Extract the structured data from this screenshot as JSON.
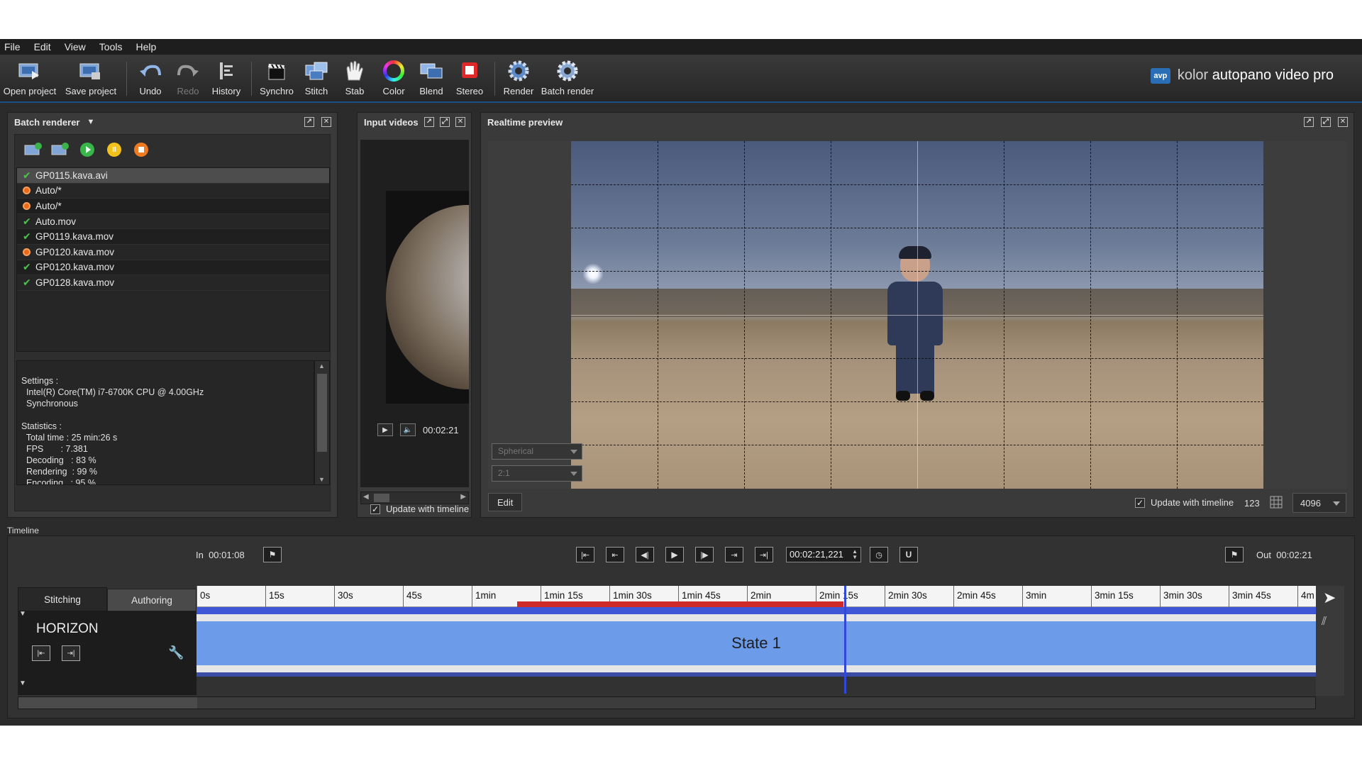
{
  "menu": [
    "File",
    "Edit",
    "View",
    "Tools",
    "Help"
  ],
  "toolbar": {
    "open_project": "Open project",
    "save_project": "Save project",
    "undo": "Undo",
    "redo": "Redo",
    "history": "History",
    "synchro": "Synchro",
    "stitch": "Stitch",
    "stab": "Stab",
    "color": "Color",
    "blend": "Blend",
    "stereo": "Stereo",
    "render": "Render",
    "batch_render": "Batch render"
  },
  "brand": {
    "logo": "avp",
    "prefix": "kolor ",
    "name": "autopano video pro"
  },
  "batch_renderer": {
    "title": "Batch renderer",
    "items": [
      {
        "name": "GP0115.kava.avi",
        "status": "ok"
      },
      {
        "name": "Auto/*",
        "status": "error"
      },
      {
        "name": "Auto/*",
        "status": "error"
      },
      {
        "name": "Auto.mov",
        "status": "ok"
      },
      {
        "name": "GP0119.kava.mov",
        "status": "ok"
      },
      {
        "name": "GP0120.kava.mov",
        "status": "error"
      },
      {
        "name": "GP0120.kava.mov",
        "status": "ok"
      },
      {
        "name": "GP0128.kava.mov",
        "status": "ok"
      }
    ],
    "info": "Settings :\n  Intel(R) Core(TM) i7-6700K CPU @ 4.00GHz\n  Synchronous\n\nStatistics :\n  Total time : 25 min:26 s\n  FPS       : 7.381\n  Decoding   : 83 %\n  Rendering  : 99 %\n  Encoding   : 95 %"
  },
  "input_videos": {
    "title": "Input videos",
    "time": "00:02:21",
    "update_label": "Update with timeline"
  },
  "realtime_preview": {
    "title": "Realtime preview",
    "projection": "Spherical",
    "ratio": "2:1",
    "edit_label": "Edit",
    "update_label": "Update with timeline",
    "fps": "123",
    "resolution": "4096"
  },
  "timeline": {
    "title": "Timeline",
    "in_label": "In",
    "in_time": "00:01:08",
    "out_label": "Out",
    "out_time": "00:02:21",
    "current_time": "00:02:21,221",
    "tabs": [
      "Stitching",
      "Authoring"
    ],
    "track_name": "HORIZON",
    "state_label": "State 1",
    "ticks": [
      "0s",
      "15s",
      "30s",
      "45s",
      "1min",
      "1min 15s",
      "1min 30s",
      "1min 45s",
      "2min",
      "2min 15s",
      "2min 30s",
      "2min 45s",
      "3min",
      "3min 15s",
      "3min 30s",
      "3min 45s",
      "4m"
    ]
  }
}
